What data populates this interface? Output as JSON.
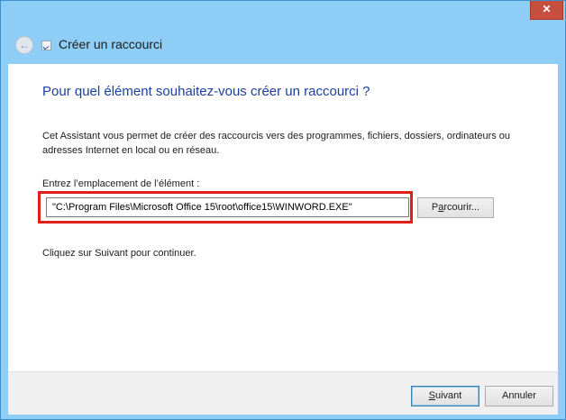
{
  "window": {
    "close_glyph": "✕",
    "title": "Créer un raccourci"
  },
  "content": {
    "heading": "Pour quel élément souhaitez-vous créer un raccourci ?",
    "description": "Cet Assistant vous permet de créer des raccourcis vers des programmes, fichiers, dossiers, ordinateurs ou adresses Internet en local ou en réseau.",
    "location_label": "Entrez l’emplacement de l’élément :",
    "location_value": "\"C:\\Program Files\\Microsoft Office 15\\root\\office15\\WINWORD.EXE\"",
    "browse_label_prefix": "P",
    "browse_label_access": "a",
    "browse_label_rest": "rcourir...",
    "hint": "Cliquez sur Suivant pour continuer."
  },
  "footer": {
    "next_access": "S",
    "next_rest": "uivant",
    "cancel": "Annuler"
  },
  "colors": {
    "frame": "#8ecdf5",
    "heading": "#1c3fa0",
    "highlight": "#e0201b",
    "close": "#c74f3f"
  }
}
